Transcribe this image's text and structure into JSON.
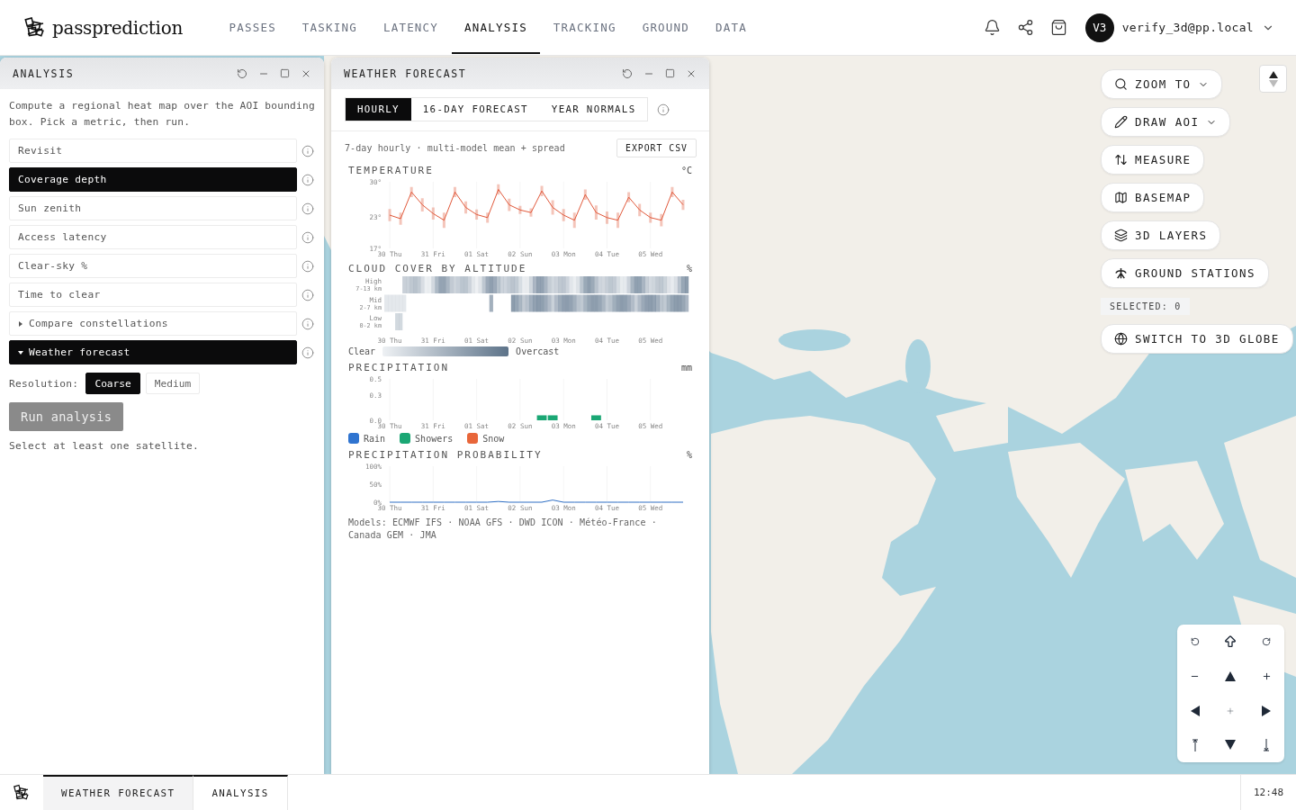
{
  "brand": {
    "name": "passprediction"
  },
  "nav": [
    {
      "label": "PASSES",
      "selected": false
    },
    {
      "label": "TASKING",
      "selected": false
    },
    {
      "label": "LATENCY",
      "selected": false
    },
    {
      "label": "ANALYSIS",
      "selected": true
    },
    {
      "label": "TRACKING",
      "selected": false
    },
    {
      "label": "GROUND",
      "selected": false
    },
    {
      "label": "DATA",
      "selected": false
    }
  ],
  "user": {
    "initials": "V3",
    "email": "verify_3d@pp.local"
  },
  "analysis_window": {
    "title": "ANALYSIS",
    "description": "Compute a regional heat map over the AOI bounding box. Pick a metric, then run.",
    "metrics": [
      {
        "label": "Revisit",
        "kind": "metric",
        "selected": false
      },
      {
        "label": "Coverage depth",
        "kind": "metric",
        "selected": true
      },
      {
        "label": "Sun zenith",
        "kind": "metric",
        "selected": false
      },
      {
        "label": "Access latency",
        "kind": "metric",
        "selected": false
      },
      {
        "label": "Clear-sky %",
        "kind": "metric",
        "selected": false
      },
      {
        "label": "Time to clear",
        "kind": "metric",
        "selected": false
      },
      {
        "label": "Compare constellations",
        "kind": "group",
        "expanded": false,
        "selected": false
      },
      {
        "label": "Weather forecast",
        "kind": "group",
        "expanded": true,
        "selected": true
      }
    ],
    "resolution": {
      "label": "Resolution:",
      "options": [
        {
          "label": "Coarse",
          "selected": true
        },
        {
          "label": "Medium",
          "selected": false
        }
      ]
    },
    "run_button": {
      "label": "Run analysis",
      "disabled": true
    },
    "hint": "Select at least one satellite."
  },
  "weather_window": {
    "title": "WEATHER FORECAST",
    "tabs": [
      {
        "label": "HOURLY",
        "selected": true
      },
      {
        "label": "16-DAY FORECAST",
        "selected": false
      },
      {
        "label": "YEAR NORMALS",
        "selected": false
      }
    ],
    "subtitle": "7-day hourly · multi-model mean + spread",
    "export_button": "EXPORT CSV",
    "temperature": {
      "title": "TEMPERATURE",
      "unit": "°C",
      "chart_data": {
        "type": "line",
        "grid": true,
        "ylim": [
          17,
          30
        ],
        "categories": [
          "30 Thu",
          null,
          null,
          null,
          "31 Fri",
          null,
          null,
          null,
          "01 Sat",
          null,
          null,
          null,
          "02 Sun",
          null,
          null,
          null,
          "03 Mon",
          null,
          null,
          null,
          "04 Tue",
          null,
          null,
          null,
          "05 Wed",
          null,
          null,
          null
        ],
        "yticks": [
          {
            "value": 30,
            "label": "30°"
          },
          {
            "value": 23,
            "label": "23°"
          },
          {
            "value": 17,
            "label": "17°"
          }
        ],
        "series": [
          {
            "color": "#e0583a",
            "values": [
              23.5,
              22.8,
              28,
              25.5,
              23.8,
              22.5,
              28,
              25,
              23.6,
              23,
              28.5,
              25.5,
              24.5,
              24,
              28.2,
              25,
              23.5,
              22.5,
              27.5,
              24,
              23,
              22.5,
              27,
              24.5,
              23,
              22.5,
              28,
              25.5
            ],
            "errors": [
              1.2,
              1.2,
              1,
              1.3,
              1.2,
              1.5,
              1,
              1.2,
              1,
              1,
              1,
              1.2,
              0.8,
              0.8,
              1,
              1.4,
              1.2,
              1.5,
              1,
              1.4,
              1.2,
              1.5,
              1,
              1.2,
              1,
              1.2,
              1,
              1
            ]
          }
        ]
      }
    },
    "cloud_cover": {
      "title": "CLOUD COVER BY ALTITUDE",
      "unit": "%",
      "rows": [
        {
          "label": "High",
          "sublabel": "7-13 km"
        },
        {
          "label": "Mid",
          "sublabel": "2-7 km"
        },
        {
          "label": "Low",
          "sublabel": "0-2 km"
        }
      ],
      "xticks": [
        "30 Thu",
        "31 Fri",
        "01 Sat",
        "02 Sun",
        "03 Mon",
        "04 Tue",
        "05 Wed"
      ],
      "legend_low": "Clear",
      "legend_high": "Overcast"
    },
    "precipitation": {
      "title": "PRECIPITATION",
      "unit": "mm",
      "chart_data": {
        "type": "bar",
        "grid": true,
        "stacked": true,
        "ylim": [
          0,
          0.5
        ],
        "categories": [
          "30 Thu",
          null,
          null,
          null,
          "31 Fri",
          null,
          null,
          null,
          "01 Sat",
          null,
          null,
          null,
          "02 Sun",
          null,
          null,
          null,
          "03 Mon",
          null,
          null,
          null,
          "04 Tue",
          null,
          null,
          null,
          "05 Wed",
          null,
          null,
          null
        ],
        "yticks": [
          {
            "value": 0.5,
            "label": "0.5"
          },
          {
            "value": 0.3,
            "label": "0.3"
          },
          {
            "value": 0,
            "label": "0.0"
          }
        ],
        "series": [
          {
            "name": "Rain",
            "color": "#2f74d0",
            "values": [
              0,
              0,
              0,
              0,
              0,
              0,
              0,
              0,
              0,
              0,
              0,
              0,
              0,
              0,
              0,
              0,
              0,
              0,
              0,
              0,
              0,
              0,
              0,
              0,
              0,
              0,
              0,
              0
            ]
          },
          {
            "name": "Showers",
            "color": "#1aa774",
            "values": [
              0,
              0,
              0,
              0,
              0,
              0,
              0,
              0,
              0,
              0,
              0,
              0,
              0,
              0,
              0.06,
              0.06,
              0,
              0,
              0,
              0.06,
              0,
              0,
              0,
              0,
              0,
              0,
              0,
              0
            ]
          },
          {
            "name": "Snow",
            "color": "#e8663a",
            "values": [
              0,
              0,
              0,
              0,
              0,
              0,
              0,
              0,
              0,
              0,
              0,
              0,
              0,
              0,
              0,
              0,
              0,
              0,
              0,
              0,
              0,
              0,
              0,
              0,
              0,
              0,
              0,
              0
            ]
          }
        ]
      }
    },
    "probability": {
      "title": "PRECIPITATION PROBABILITY",
      "unit": "%",
      "chart_data": {
        "type": "line",
        "grid": true,
        "ylim": [
          0,
          100
        ],
        "categories": [
          "30 Thu",
          null,
          null,
          null,
          "31 Fri",
          null,
          null,
          null,
          "01 Sat",
          null,
          null,
          null,
          "02 Sun",
          null,
          null,
          null,
          "03 Mon",
          null,
          null,
          null,
          "04 Tue",
          null,
          null,
          null,
          "05 Wed",
          null,
          null,
          null
        ],
        "yticks": [
          {
            "value": 100,
            "label": "100%"
          },
          {
            "value": 50,
            "label": "50%"
          },
          {
            "value": 0,
            "label": "0%"
          }
        ],
        "series": [
          {
            "color": "#2f6fc4",
            "values": [
              0,
              0,
              0,
              0,
              0,
              0,
              0,
              0,
              0,
              0,
              2,
              0,
              0,
              0,
              0,
              6,
              0,
              0,
              0,
              0,
              0,
              0,
              0,
              0,
              0,
              0,
              0,
              0
            ]
          }
        ]
      }
    },
    "models": "Models: ECMWF IFS · NOAA GFS · DWD ICON · Météo-France · Canada GEM · JMA"
  },
  "map_controls": {
    "buttons": [
      {
        "label": "ZOOM TO",
        "dropdown": true
      },
      {
        "label": "DRAW AOI",
        "dropdown": true
      },
      {
        "label": "MEASURE",
        "dropdown": false
      },
      {
        "label": "BASEMAP",
        "dropdown": false
      },
      {
        "label": "3D LAYERS",
        "dropdown": false
      },
      {
        "label": "GROUND STATIONS",
        "dropdown": false
      }
    ],
    "selection": "SELECTED: 0",
    "globe_button": {
      "label": "SWITCH TO 3D GLOBE"
    }
  },
  "taskbar": {
    "tabs": [
      {
        "label": "WEATHER FORECAST",
        "selected": true
      },
      {
        "label": "ANALYSIS",
        "selected": false
      }
    ],
    "clock": "12:48"
  }
}
